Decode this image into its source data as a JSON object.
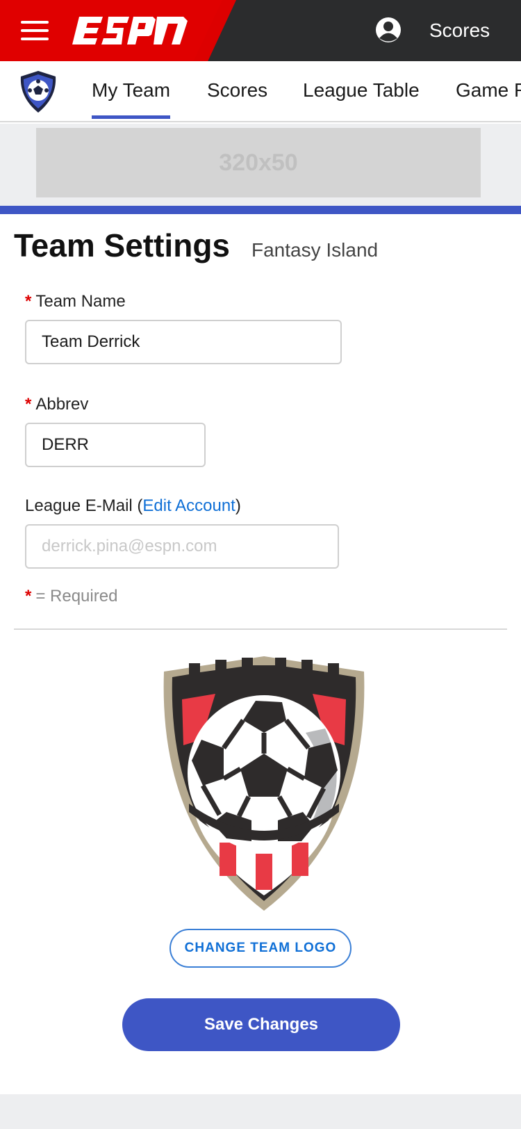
{
  "header": {
    "brand": "ESPN",
    "scores_label": "Scores",
    "menu_icon": "hamburger-menu-icon",
    "profile_icon": "user-profile-icon",
    "accent_red": "#e00000",
    "bar_color": "#2b2c2d"
  },
  "subnav": {
    "league_icon": "soccer-ball-shield-icon",
    "tabs": [
      {
        "label": "My Team",
        "active": true
      },
      {
        "label": "Scores"
      },
      {
        "label": "League Table"
      },
      {
        "label": "Game R"
      }
    ]
  },
  "ad": {
    "label": "320x50"
  },
  "settings": {
    "title": "Team Settings",
    "league_name": "Fantasy Island",
    "team_name": {
      "required_mark": "*",
      "label": "Team Name",
      "value": "Team Derrick"
    },
    "abbrev": {
      "required_mark": "*",
      "label": "Abbrev",
      "value": "DERR"
    },
    "email": {
      "label_prefix": "League E-Mail (",
      "link": "Edit Account",
      "label_suffix": ")",
      "placeholder": "derrick.pina@espn.com"
    },
    "required_note": {
      "mark": "*",
      "text": "= Required"
    },
    "logo_icon": "soccer-crest-logo",
    "change_logo_label": "CHANGE TEAM LOGO",
    "save_label": "Save Changes",
    "primary_color": "#3e56c5",
    "link_color": "#0f6fd6"
  }
}
